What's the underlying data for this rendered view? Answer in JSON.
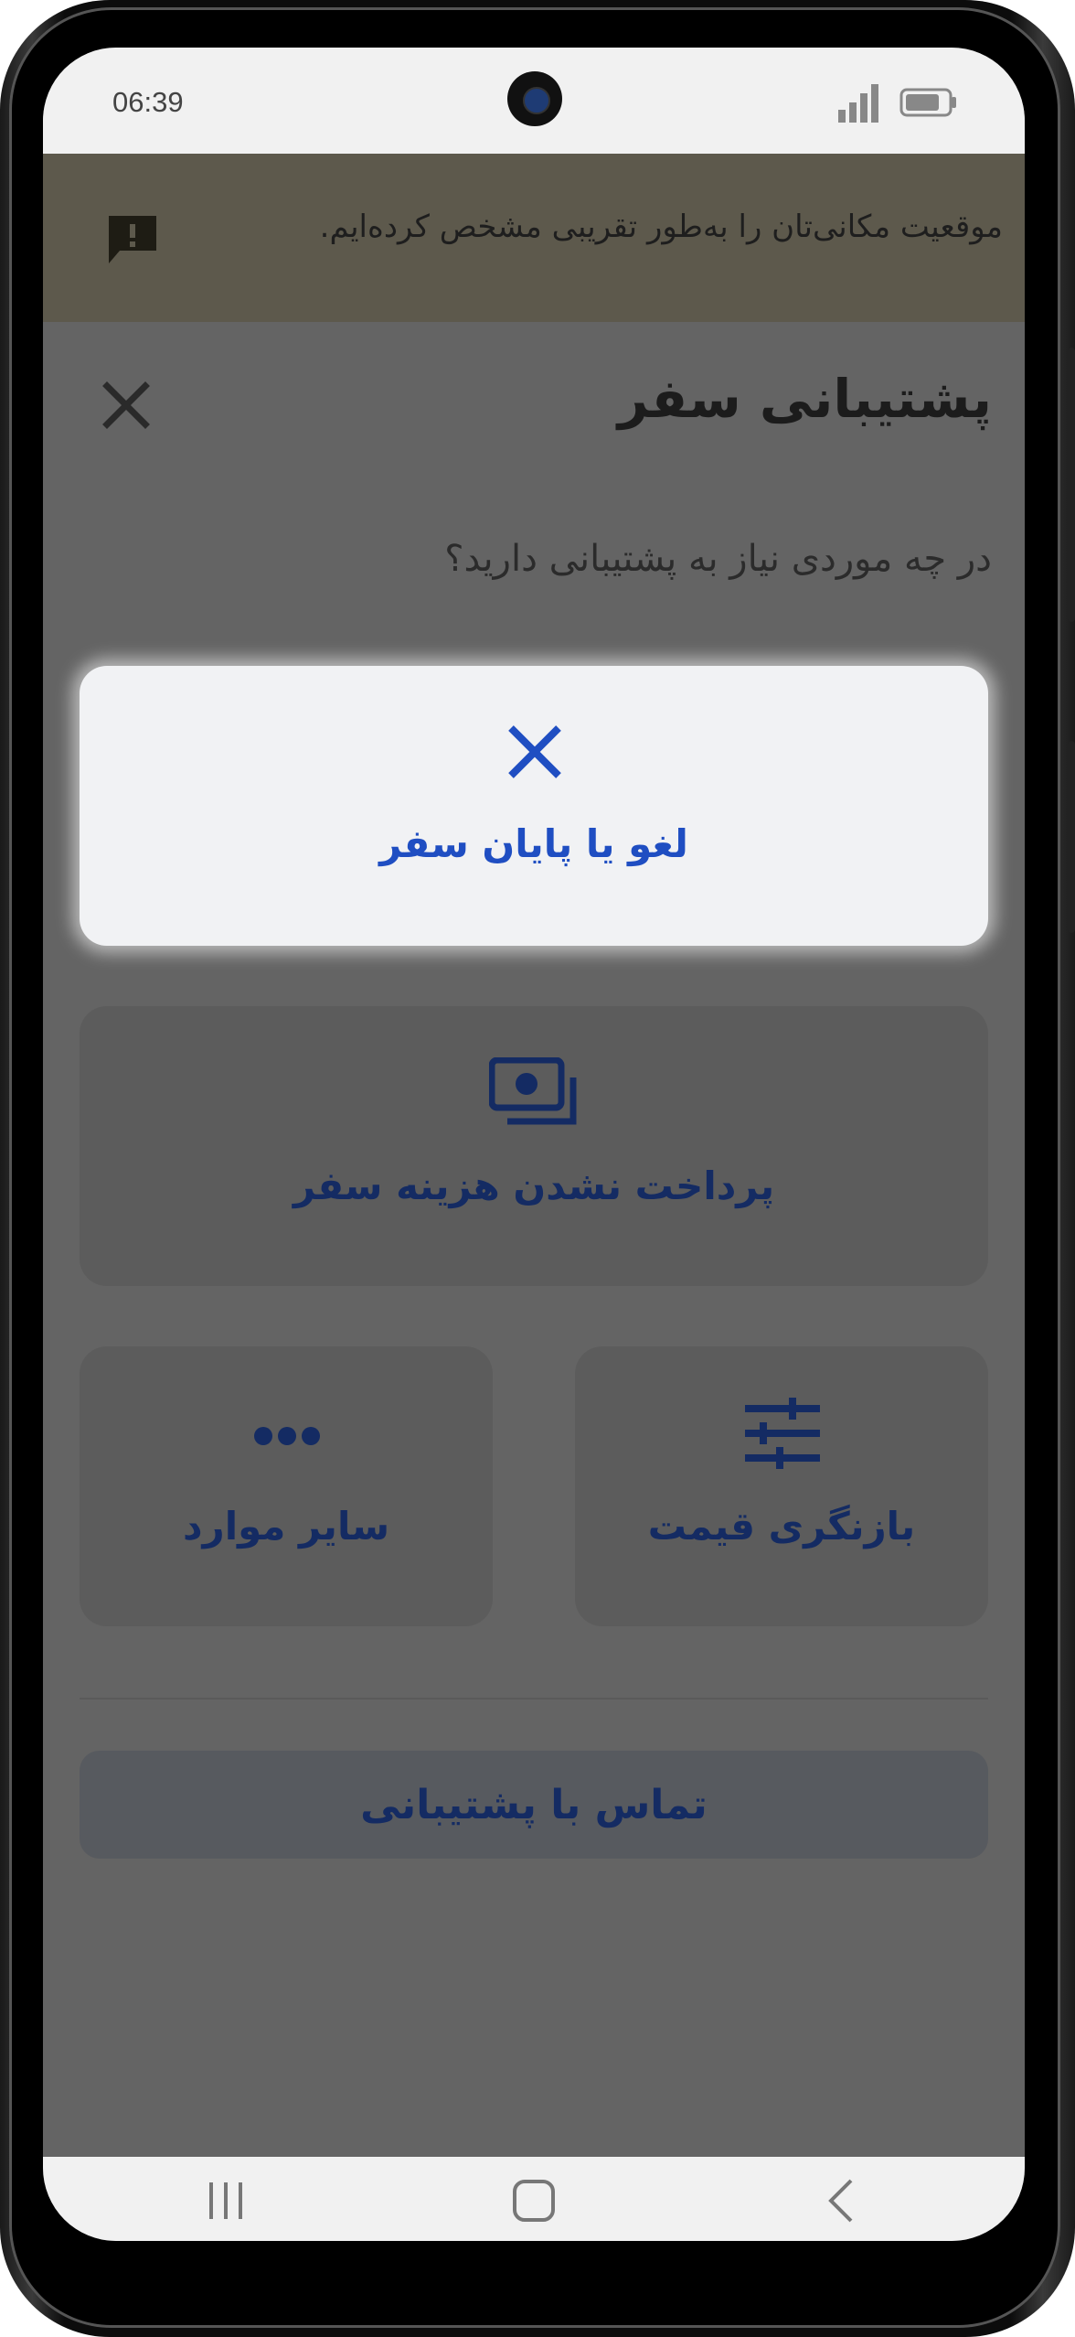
{
  "status_bar": {
    "time": "06:39",
    "icons": [
      "signal-icon",
      "battery-icon"
    ]
  },
  "banner": {
    "text": "موقعیت مکانی‌تان را به‌طور تقریبی مشخص کرده‌ایم.",
    "icon": "feedback-icon"
  },
  "sheet": {
    "title": "پشتیبانی سفر",
    "question": "در چه موردی نیاز به پشتیبانی دارید؟",
    "close_icon": "close-icon"
  },
  "options": [
    {
      "label": "لغو یا پایان سفر",
      "icon": "close-icon",
      "selected": true
    },
    {
      "label": "پرداخت نشدن هزینه سفر",
      "icon": "payment-icon",
      "selected": false
    },
    {
      "label": "بازنگری قیمت",
      "icon": "sliders-icon",
      "selected": false
    },
    {
      "label": "سایر موارد",
      "icon": "more-dots-icon",
      "selected": false
    }
  ],
  "contact_button": {
    "label": "تماس با پشتیبانی"
  },
  "nav_bar": {
    "items": [
      "recent-apps-icon",
      "home-icon",
      "back-icon"
    ]
  },
  "colors": {
    "accent": "#1f4ec2",
    "accent_dim": "#142b63",
    "overlay": "#646464",
    "banner": "#5d594c"
  }
}
